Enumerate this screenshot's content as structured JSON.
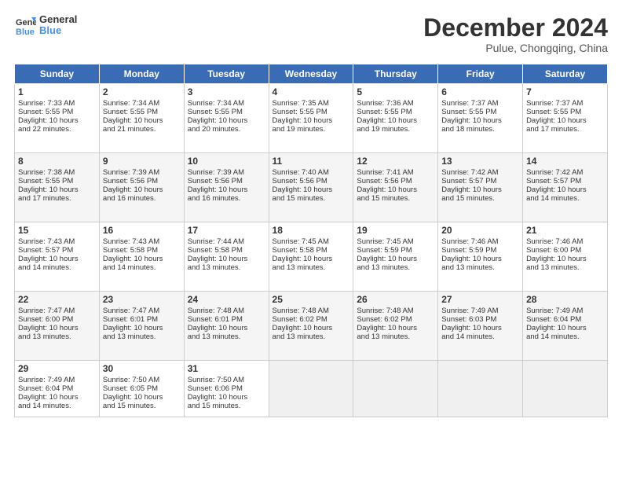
{
  "header": {
    "logo_line1": "General",
    "logo_line2": "Blue",
    "month": "December 2024",
    "location": "Pulue, Chongqing, China"
  },
  "weekdays": [
    "Sunday",
    "Monday",
    "Tuesday",
    "Wednesday",
    "Thursday",
    "Friday",
    "Saturday"
  ],
  "weeks": [
    [
      {
        "day": "1",
        "lines": [
          "Sunrise: 7:33 AM",
          "Sunset: 5:55 PM",
          "Daylight: 10 hours",
          "and 22 minutes."
        ]
      },
      {
        "day": "2",
        "lines": [
          "Sunrise: 7:34 AM",
          "Sunset: 5:55 PM",
          "Daylight: 10 hours",
          "and 21 minutes."
        ]
      },
      {
        "day": "3",
        "lines": [
          "Sunrise: 7:34 AM",
          "Sunset: 5:55 PM",
          "Daylight: 10 hours",
          "and 20 minutes."
        ]
      },
      {
        "day": "4",
        "lines": [
          "Sunrise: 7:35 AM",
          "Sunset: 5:55 PM",
          "Daylight: 10 hours",
          "and 19 minutes."
        ]
      },
      {
        "day": "5",
        "lines": [
          "Sunrise: 7:36 AM",
          "Sunset: 5:55 PM",
          "Daylight: 10 hours",
          "and 19 minutes."
        ]
      },
      {
        "day": "6",
        "lines": [
          "Sunrise: 7:37 AM",
          "Sunset: 5:55 PM",
          "Daylight: 10 hours",
          "and 18 minutes."
        ]
      },
      {
        "day": "7",
        "lines": [
          "Sunrise: 7:37 AM",
          "Sunset: 5:55 PM",
          "Daylight: 10 hours",
          "and 17 minutes."
        ]
      }
    ],
    [
      {
        "day": "8",
        "lines": [
          "Sunrise: 7:38 AM",
          "Sunset: 5:55 PM",
          "Daylight: 10 hours",
          "and 17 minutes."
        ]
      },
      {
        "day": "9",
        "lines": [
          "Sunrise: 7:39 AM",
          "Sunset: 5:56 PM",
          "Daylight: 10 hours",
          "and 16 minutes."
        ]
      },
      {
        "day": "10",
        "lines": [
          "Sunrise: 7:39 AM",
          "Sunset: 5:56 PM",
          "Daylight: 10 hours",
          "and 16 minutes."
        ]
      },
      {
        "day": "11",
        "lines": [
          "Sunrise: 7:40 AM",
          "Sunset: 5:56 PM",
          "Daylight: 10 hours",
          "and 15 minutes."
        ]
      },
      {
        "day": "12",
        "lines": [
          "Sunrise: 7:41 AM",
          "Sunset: 5:56 PM",
          "Daylight: 10 hours",
          "and 15 minutes."
        ]
      },
      {
        "day": "13",
        "lines": [
          "Sunrise: 7:42 AM",
          "Sunset: 5:57 PM",
          "Daylight: 10 hours",
          "and 15 minutes."
        ]
      },
      {
        "day": "14",
        "lines": [
          "Sunrise: 7:42 AM",
          "Sunset: 5:57 PM",
          "Daylight: 10 hours",
          "and 14 minutes."
        ]
      }
    ],
    [
      {
        "day": "15",
        "lines": [
          "Sunrise: 7:43 AM",
          "Sunset: 5:57 PM",
          "Daylight: 10 hours",
          "and 14 minutes."
        ]
      },
      {
        "day": "16",
        "lines": [
          "Sunrise: 7:43 AM",
          "Sunset: 5:58 PM",
          "Daylight: 10 hours",
          "and 14 minutes."
        ]
      },
      {
        "day": "17",
        "lines": [
          "Sunrise: 7:44 AM",
          "Sunset: 5:58 PM",
          "Daylight: 10 hours",
          "and 13 minutes."
        ]
      },
      {
        "day": "18",
        "lines": [
          "Sunrise: 7:45 AM",
          "Sunset: 5:58 PM",
          "Daylight: 10 hours",
          "and 13 minutes."
        ]
      },
      {
        "day": "19",
        "lines": [
          "Sunrise: 7:45 AM",
          "Sunset: 5:59 PM",
          "Daylight: 10 hours",
          "and 13 minutes."
        ]
      },
      {
        "day": "20",
        "lines": [
          "Sunrise: 7:46 AM",
          "Sunset: 5:59 PM",
          "Daylight: 10 hours",
          "and 13 minutes."
        ]
      },
      {
        "day": "21",
        "lines": [
          "Sunrise: 7:46 AM",
          "Sunset: 6:00 PM",
          "Daylight: 10 hours",
          "and 13 minutes."
        ]
      }
    ],
    [
      {
        "day": "22",
        "lines": [
          "Sunrise: 7:47 AM",
          "Sunset: 6:00 PM",
          "Daylight: 10 hours",
          "and 13 minutes."
        ]
      },
      {
        "day": "23",
        "lines": [
          "Sunrise: 7:47 AM",
          "Sunset: 6:01 PM",
          "Daylight: 10 hours",
          "and 13 minutes."
        ]
      },
      {
        "day": "24",
        "lines": [
          "Sunrise: 7:48 AM",
          "Sunset: 6:01 PM",
          "Daylight: 10 hours",
          "and 13 minutes."
        ]
      },
      {
        "day": "25",
        "lines": [
          "Sunrise: 7:48 AM",
          "Sunset: 6:02 PM",
          "Daylight: 10 hours",
          "and 13 minutes."
        ]
      },
      {
        "day": "26",
        "lines": [
          "Sunrise: 7:48 AM",
          "Sunset: 6:02 PM",
          "Daylight: 10 hours",
          "and 13 minutes."
        ]
      },
      {
        "day": "27",
        "lines": [
          "Sunrise: 7:49 AM",
          "Sunset: 6:03 PM",
          "Daylight: 10 hours",
          "and 14 minutes."
        ]
      },
      {
        "day": "28",
        "lines": [
          "Sunrise: 7:49 AM",
          "Sunset: 6:04 PM",
          "Daylight: 10 hours",
          "and 14 minutes."
        ]
      }
    ],
    [
      {
        "day": "29",
        "lines": [
          "Sunrise: 7:49 AM",
          "Sunset: 6:04 PM",
          "Daylight: 10 hours",
          "and 14 minutes."
        ]
      },
      {
        "day": "30",
        "lines": [
          "Sunrise: 7:50 AM",
          "Sunset: 6:05 PM",
          "Daylight: 10 hours",
          "and 15 minutes."
        ]
      },
      {
        "day": "31",
        "lines": [
          "Sunrise: 7:50 AM",
          "Sunset: 6:06 PM",
          "Daylight: 10 hours",
          "and 15 minutes."
        ]
      },
      {
        "day": "",
        "lines": []
      },
      {
        "day": "",
        "lines": []
      },
      {
        "day": "",
        "lines": []
      },
      {
        "day": "",
        "lines": []
      }
    ]
  ]
}
